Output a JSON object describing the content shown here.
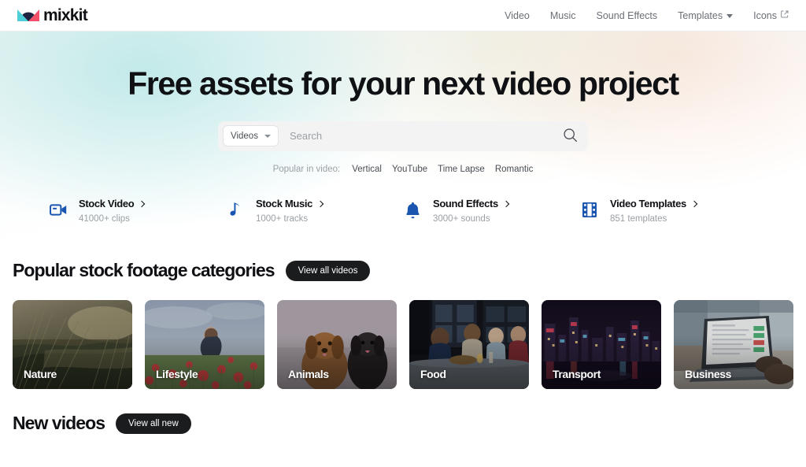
{
  "brand": {
    "name": "mixkit",
    "logo_icon": "mixkit-logo-icon",
    "colors": {
      "cyan": "#4ecfd8",
      "red": "#f2506a",
      "navy": "#1d2340",
      "accent_blue": "#1a56b0",
      "dark": "#1b1c1e"
    }
  },
  "nav": {
    "items": [
      {
        "label": "Video",
        "icon": null
      },
      {
        "label": "Music",
        "icon": null
      },
      {
        "label": "Sound Effects",
        "icon": null
      },
      {
        "label": "Templates",
        "icon": "chevron-down-icon"
      },
      {
        "label": "Icons",
        "icon": "external-link-icon"
      }
    ]
  },
  "hero": {
    "title": "Free assets for your next video project",
    "search": {
      "type_label": "Videos",
      "type_icon": "chevron-down-icon",
      "value": "",
      "placeholder": "Search",
      "submit_icon": "search-icon"
    },
    "popular": {
      "label": "Popular in video:",
      "tags": [
        "Vertical",
        "YouTube",
        "Time Lapse",
        "Romantic"
      ]
    },
    "quick_links": [
      {
        "icon": "video-camera-icon",
        "title": "Stock Video",
        "chevron": "chevron-right-icon",
        "subtitle": "41000+ clips"
      },
      {
        "icon": "music-note-icon",
        "title": "Stock Music",
        "chevron": "chevron-right-icon",
        "subtitle": "1000+ tracks"
      },
      {
        "icon": "bell-icon",
        "title": "Sound Effects",
        "chevron": "chevron-right-icon",
        "subtitle": "3000+ sounds"
      },
      {
        "icon": "film-strip-icon",
        "title": "Video Templates",
        "chevron": "chevron-right-icon",
        "subtitle": "851 templates"
      }
    ]
  },
  "sections": {
    "categories": {
      "title": "Popular stock footage categories",
      "button_label": "View all videos",
      "cards": [
        {
          "label": "Nature"
        },
        {
          "label": "Lifestyle"
        },
        {
          "label": "Animals"
        },
        {
          "label": "Food"
        },
        {
          "label": "Transport"
        },
        {
          "label": "Business"
        }
      ]
    },
    "new_videos": {
      "title": "New videos",
      "button_label": "View all new"
    }
  }
}
